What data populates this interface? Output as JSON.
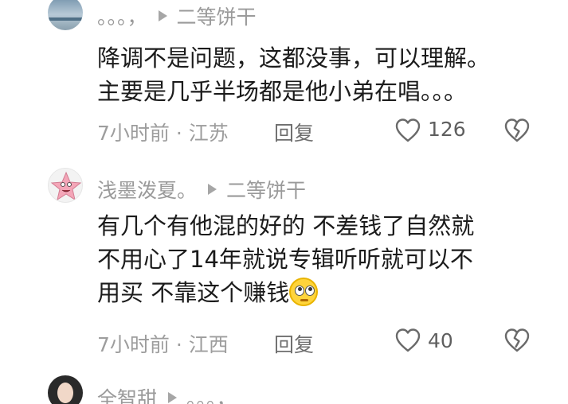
{
  "comments": [
    {
      "username": "。。。，",
      "reply_to": "二等饼干",
      "lines": [
        "降调不是问题，这都没事，可以理解。",
        "主要是几乎半场都是他小弟在唱。。。"
      ],
      "time_location": "7小时前 · 江苏",
      "reply_label": "回复",
      "like_count": "126"
    },
    {
      "username": "浅墨泼夏。",
      "reply_to": "二等饼干",
      "lines": [
        "有几个有他混的好的 不差钱了自然就",
        "不用心了14年就说专辑听听就可以不",
        "用买 不靠这个赚钱"
      ],
      "emoji": "rolling-eyes-emoji",
      "time_location": "7小时前 · 江西",
      "reply_label": "回复",
      "like_count": "40"
    },
    {
      "username": "全智甜",
      "reply_to": "。。。，"
    }
  ]
}
